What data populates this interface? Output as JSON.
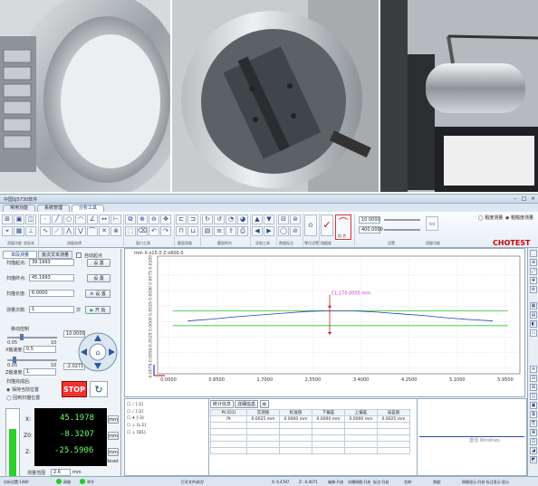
{
  "app": {
    "title": "中国SJ5730软件",
    "window_buttons": [
      "–",
      "□",
      "×"
    ]
  },
  "main_tabs": [
    "常用功能",
    "系统管理",
    "分析工具"
  ],
  "active_main_tab": 2,
  "ribbon": {
    "group_labels": [
      "测量功能",
      "坐标系",
      "测量选择",
      "窗口工具",
      "截面测量",
      "圆弧转台",
      "导航工具",
      "数据标注",
      "零位设置",
      "粗糙度",
      "设置",
      "测量功能"
    ],
    "highlight_button": "拟 合",
    "check_label": "粗糙",
    "slider_values": [
      "10.0000",
      "400.0000"
    ],
    "radio_options": [
      "粗度测量",
      "粗糙度测量"
    ],
    "logo": "CHOTEST"
  },
  "left_panel": {
    "tabs": [
      "单段测量",
      "批次文本测量"
    ],
    "auto_start_label": "自动起点",
    "fields": [
      {
        "label": "扫描起点:",
        "value": "39.1993",
        "button": "设 置"
      },
      {
        "label": "扫描终点:",
        "value": "45.1993",
        "button": "设 置"
      },
      {
        "label": "扫描长度:",
        "value": "6.0000",
        "button": "设 置"
      },
      {
        "label": "测量次数:",
        "value": "1",
        "button": "开 始"
      }
    ],
    "move_control_label": "移动控制",
    "x_speed_label": "X轴速度:",
    "x_speed_value": "0.5",
    "z_speed_label": "Z轴速度:",
    "z_speed_value": "1",
    "slider_ticks": [
      "0.05",
      "10",
      "0.05",
      "10"
    ],
    "dpad_values": [
      "10.0000",
      "-2.0271"
    ],
    "scan_done_label": "扫描完成后:",
    "scan_done_options": [
      "保持当前位置",
      "回到扫描位置"
    ],
    "stop_label": "STOP",
    "dro": {
      "labels": [
        "X:",
        "Z0:",
        "Z:"
      ],
      "values": [
        "45.1978",
        "-8.3207",
        "-25.5906"
      ],
      "unit": "mm",
      "reset_label": "Reset"
    },
    "range_label": "测量范围",
    "range_value": "2.6",
    "range_unit": "mm"
  },
  "chart_data": {
    "type": "line",
    "header": "mm   X:x15.0  Z:x600.0",
    "x_ticks": [
      "0.0000",
      "0.8500",
      "1.7000",
      "2.5500",
      "3.4000",
      "4.2500",
      "5.1000",
      "5.9500"
    ],
    "y_ticks": [
      "0.0100",
      "0.0075",
      "0.0050",
      "0.0025",
      "0.0000",
      "-0.0025",
      "-0.0050",
      "-0.0075"
    ],
    "xlim": [
      0,
      6
    ],
    "ylim": [
      -0.0088,
      0.011
    ],
    "marker_label": "CL:170.0005 mm",
    "marker_x": 2.85,
    "green_band": [
      0.0018,
      -0.0007
    ],
    "series": [
      {
        "x": [
          0.5,
          0.9,
          1.3,
          1.7,
          2.1,
          2.5,
          2.85,
          3.2,
          3.6,
          4.0,
          4.4,
          4.8,
          5.2,
          5.55
        ],
        "values": [
          0.0001,
          0.0004,
          0.0008,
          0.0011,
          0.0014,
          0.0017,
          0.0018,
          0.0018,
          0.0016,
          0.0013,
          0.001,
          0.0006,
          0.0003,
          0.0001
        ]
      }
    ]
  },
  "bottom": {
    "product_items": [
      "[-1]",
      "[-2]",
      "[-3]",
      "[L.1]",
      "[D1]"
    ],
    "tabs": [
      "统计信息",
      "详细信息"
    ],
    "table_headers": [
      "Pt.[D1]",
      "实测值",
      "标准值",
      "下偏差",
      "上偏差",
      "误差值"
    ],
    "table_row": [
      "Pt",
      "0.0025 mm",
      "0.0000 mm",
      "0.0000 mm",
      "0.0000 mm",
      "0.0025 mm"
    ],
    "watermark": "激活 Windows"
  },
  "statusbar": {
    "left": "分析设置:1480",
    "indicators": [
      "网络",
      "命令"
    ],
    "message": "打开文件成功!",
    "x": "X: 6.4787",
    "z": "Z: -0.0071",
    "items": [
      "轴移:开启",
      "光栅网格:开启",
      "标注:开启",
      "名称:",
      "角度:"
    ],
    "right": "网格显示:开启   标注显示:显示"
  }
}
